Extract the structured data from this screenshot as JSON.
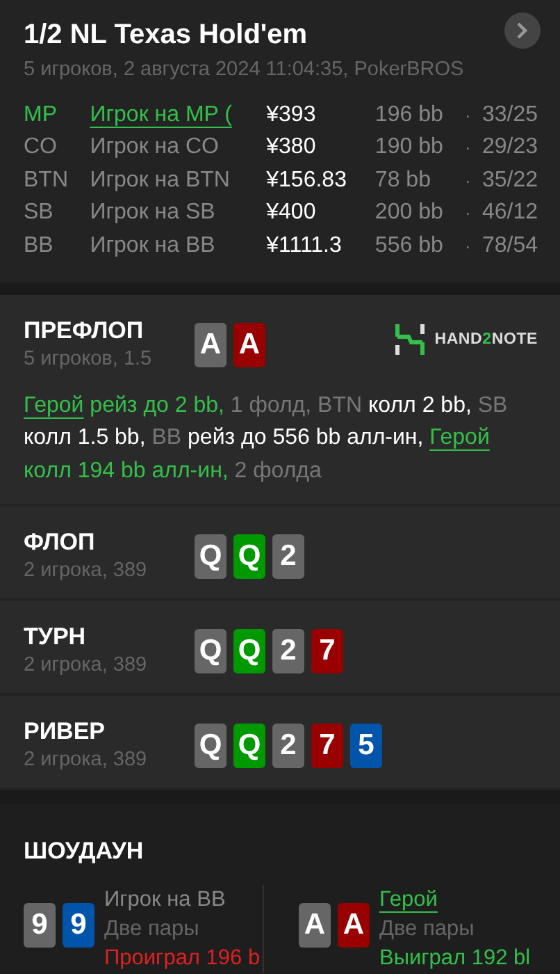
{
  "header": {
    "title": "1/2 NL Texas Hold'em",
    "subtitle": "5 игроков, 2 августа 2024 11:04:35, PokerBROS"
  },
  "players": [
    {
      "position": "MP",
      "name": "Игрок на MP (",
      "stack": "¥393",
      "bb": "196 bb",
      "separator": "·",
      "stats": "33/25",
      "hero": true
    },
    {
      "position": "CO",
      "name": "Игрок на CO",
      "stack": "¥380",
      "bb": "190 bb",
      "separator": "·",
      "stats": "29/23",
      "hero": false
    },
    {
      "position": "BTN",
      "name": "Игрок на BTN",
      "stack": "¥156.83",
      "bb": "78 bb",
      "separator": "·",
      "stats": "35/22",
      "hero": false
    },
    {
      "position": "SB",
      "name": "Игрок на SB",
      "stack": "¥400",
      "bb": "200 bb",
      "separator": "·",
      "stats": "46/12",
      "hero": false
    },
    {
      "position": "BB",
      "name": "Игрок на BB",
      "stack": "¥1111.3",
      "bb": "556 bb",
      "separator": "·",
      "stats": "78/54",
      "hero": false
    }
  ],
  "streets": [
    {
      "title": "ПРЕФЛОП",
      "info": "5 игроков, 1.5",
      "cards": [
        {
          "rank": "A",
          "color": "#666666"
        },
        {
          "rank": "A",
          "color": "#990000"
        }
      ],
      "logo": [
        {
          "text": "HAND",
          "kind": "plain"
        },
        {
          "text": "2",
          "kind": "accent"
        },
        {
          "text": "NOTE",
          "kind": "plain"
        }
      ],
      "actions": [
        {
          "text": "Герой",
          "kind": "link"
        },
        {
          "text": " рейз до 2 bb,",
          "kind": "hero"
        },
        {
          "text": " 1 фолд, BTN ",
          "kind": "muted"
        },
        {
          "text": "колл 2 bb, ",
          "kind": "plain"
        },
        {
          "text": "SB ",
          "kind": "muted"
        },
        {
          "text": "колл 1.5 bb, ",
          "kind": "plain"
        },
        {
          "text": "BB ",
          "kind": "muted"
        },
        {
          "text": "рейз до 556 bb алл-ин, ",
          "kind": "plain"
        },
        {
          "text": "Герой",
          "kind": "link"
        },
        {
          "text": " колл 194 bb алл-ин,",
          "kind": "hero"
        },
        {
          "text": " 2 фолда",
          "kind": "muted"
        }
      ]
    },
    {
      "title": "ФЛОП",
      "info": "2 игрока, 389",
      "cards": [
        {
          "rank": "Q",
          "color": "#666666"
        },
        {
          "rank": "Q",
          "color": "#009900"
        },
        {
          "rank": "2",
          "color": "#666666"
        }
      ]
    },
    {
      "title": "ТУРН",
      "info": "2 игрока, 389",
      "cards": [
        {
          "rank": "Q",
          "color": "#666666"
        },
        {
          "rank": "Q",
          "color": "#009900"
        },
        {
          "rank": "2",
          "color": "#666666"
        },
        {
          "rank": "7",
          "color": "#990000"
        }
      ]
    },
    {
      "title": "РИВЕР",
      "info": "2 игрока, 389",
      "cards": [
        {
          "rank": "Q",
          "color": "#666666"
        },
        {
          "rank": "Q",
          "color": "#009900"
        },
        {
          "rank": "2",
          "color": "#666666"
        },
        {
          "rank": "7",
          "color": "#990000"
        },
        {
          "rank": "5",
          "color": "#0055aa"
        }
      ]
    }
  ],
  "showdown": {
    "title": "ШОУДАУН",
    "players": [
      {
        "cards": [
          {
            "rank": "9",
            "color": "#666666"
          },
          {
            "rank": "9",
            "color": "#0055aa"
          }
        ],
        "name": "Игрок на BB",
        "hero": false,
        "hand": "Две пары",
        "result": "Проиграл 196 b",
        "won": false
      },
      {
        "cards": [
          {
            "rank": "A",
            "color": "#666666"
          },
          {
            "rank": "A",
            "color": "#990000"
          }
        ],
        "name": "Герой",
        "hero": true,
        "hand": "Две пары",
        "result": "Выиграл 192 bl",
        "won": true
      }
    ]
  }
}
